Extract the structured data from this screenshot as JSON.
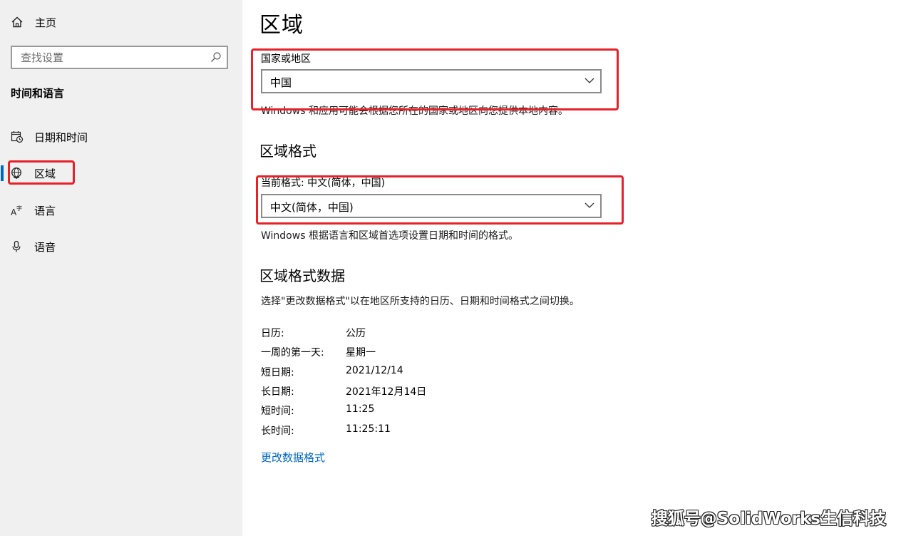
{
  "sidebar": {
    "home_label": "主页",
    "search_placeholder": "查找设置",
    "section_title": "时间和语言",
    "items": [
      {
        "label": "日期和时间",
        "icon": "calendar-clock-icon",
        "selected": false
      },
      {
        "label": "区域",
        "icon": "globe-icon",
        "selected": true
      },
      {
        "label": "语言",
        "icon": "language-icon",
        "selected": false
      },
      {
        "label": "语音",
        "icon": "microphone-icon",
        "selected": false
      }
    ]
  },
  "main": {
    "title": "区域",
    "country": {
      "label": "国家或地区",
      "value": "中国",
      "description": "Windows 和应用可能会根据您所在的国家或地区向您提供本地内容。"
    },
    "format": {
      "heading": "区域格式",
      "label": "当前格式: 中文(简体，中国)",
      "value": "中文(简体，中国)",
      "description": "Windows 根据语言和区域首选项设置日期和时间的格式。"
    },
    "format_data": {
      "heading": "区域格式数据",
      "description": "选择\"更改数据格式\"以在地区所支持的日历、日期和时间格式之间切换。",
      "rows": [
        {
          "key": "日历:",
          "value": "公历"
        },
        {
          "key": "一周的第一天:",
          "value": "星期一"
        },
        {
          "key": "短日期:",
          "value": "2021/12/14"
        },
        {
          "key": "长日期:",
          "value": "2021年12月14日"
        },
        {
          "key": "短时间:",
          "value": "11:25"
        },
        {
          "key": "长时间:",
          "value": "11:25:11"
        }
      ],
      "link": "更改数据格式"
    }
  },
  "watermark": "搜狐号@SolidWorks生信科技",
  "colors": {
    "sidebar_bg": "#f0f0f0",
    "accent": "#0067c0",
    "highlight_box": "#e8202a"
  }
}
